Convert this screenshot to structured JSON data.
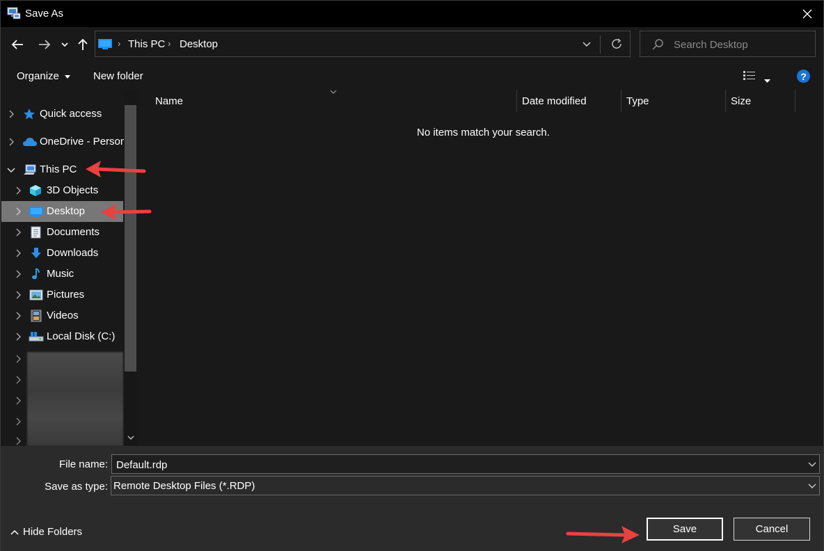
{
  "window": {
    "title": "Save As"
  },
  "address": {
    "crumbs": [
      "This PC",
      "Desktop"
    ]
  },
  "search": {
    "placeholder": "Search Desktop"
  },
  "toolbar": {
    "organize": "Organize",
    "new_folder": "New folder",
    "help": "?"
  },
  "sidebar": {
    "items": [
      {
        "label": "Quick access",
        "icon": "star-icon",
        "expanded": false
      },
      {
        "label": "OneDrive - Person",
        "icon": "cloud-icon",
        "expanded": false
      },
      {
        "label": "This PC",
        "icon": "computer-icon",
        "expanded": true
      },
      {
        "label": "3D Objects",
        "icon": "cube-icon",
        "expanded": false
      },
      {
        "label": "Desktop",
        "icon": "desktop-icon",
        "expanded": false,
        "selected": true
      },
      {
        "label": "Documents",
        "icon": "document-icon",
        "expanded": false
      },
      {
        "label": "Downloads",
        "icon": "download-arrow-icon",
        "expanded": false
      },
      {
        "label": "Music",
        "icon": "music-note-icon",
        "expanded": false
      },
      {
        "label": "Pictures",
        "icon": "picture-icon",
        "expanded": false
      },
      {
        "label": "Videos",
        "icon": "film-icon",
        "expanded": false
      },
      {
        "label": "Local Disk (C:)",
        "icon": "drive-icon",
        "expanded": false
      }
    ]
  },
  "columns": [
    "Name",
    "Date modified",
    "Type",
    "Size"
  ],
  "empty_message": "No items match your search.",
  "footer": {
    "file_name_label": "File name:",
    "file_name_value": "Default.rdp",
    "save_type_label": "Save as type:",
    "save_type_value": "Remote Desktop Files (*.RDP)",
    "hide_folders": "Hide Folders",
    "save": "Save",
    "cancel": "Cancel"
  },
  "colors": {
    "annotation_arrow": "#e8423f",
    "selected_row": "#777777",
    "help_icon": "#1a73d6"
  }
}
